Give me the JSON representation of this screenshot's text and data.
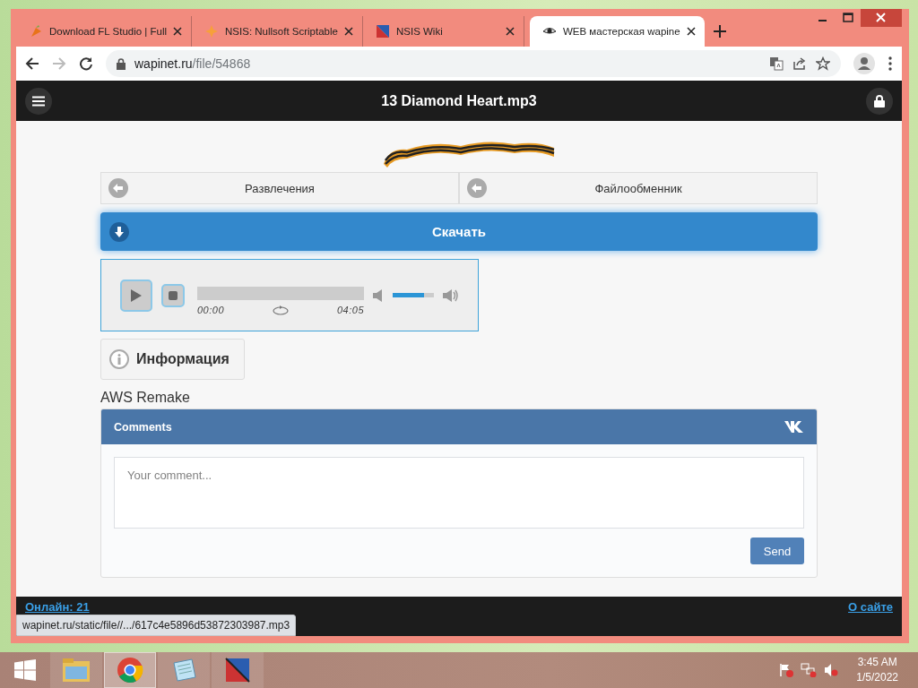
{
  "tabs": [
    {
      "title": "Download FL Studio | Full",
      "selected": false
    },
    {
      "title": "NSIS: Nullsoft Scriptable",
      "selected": false
    },
    {
      "title": "NSIS Wiki",
      "selected": false
    },
    {
      "title": "WEB мастерская wapine",
      "selected": true
    }
  ],
  "address_bar": {
    "host": "wapinet.ru",
    "path": "/file/54868"
  },
  "page": {
    "title": "13 Diamond Heart.mp3",
    "nav": [
      {
        "label": "Развлечения"
      },
      {
        "label": "Файлообменник"
      }
    ],
    "download": "Скачать",
    "player": {
      "elapsed": "00:00",
      "duration": "04:05",
      "volume": {
        "level": 0.75
      }
    },
    "info_button": "Информация",
    "description": "AWS Remake",
    "comments": {
      "title": "Comments",
      "placeholder": "Your comment...",
      "send": "Send"
    },
    "footer": {
      "online": "Онлайн: 21",
      "about": "О сайте"
    }
  },
  "status_url": "wapinet.ru/static/file//.../617c4e5896d53872303987.mp3",
  "taskbar": {
    "apps": [
      {
        "selected": false
      },
      {
        "selected": true
      },
      {
        "selected": false
      },
      {
        "selected": false
      }
    ],
    "clock": {
      "time": "3:45 AM",
      "date": "1/5/2022"
    }
  }
}
